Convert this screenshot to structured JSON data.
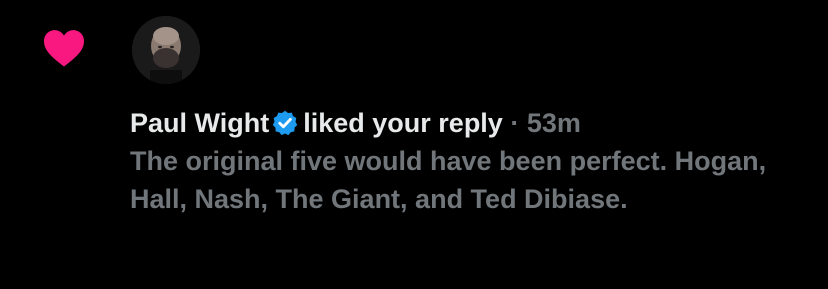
{
  "notification": {
    "type_icon": "heart-icon",
    "heart_color": "#f91880",
    "avatar": "avatar",
    "user_name": "Paul Wight",
    "verified_icon": "verified-badge-icon",
    "verified_color": "#1d9bf0",
    "action": "liked your reply",
    "separator": "·",
    "time": "53m",
    "reply_text": "The original five would have been perfect. Hogan, Hall, Nash, The Giant, and Ted Dibiase."
  }
}
